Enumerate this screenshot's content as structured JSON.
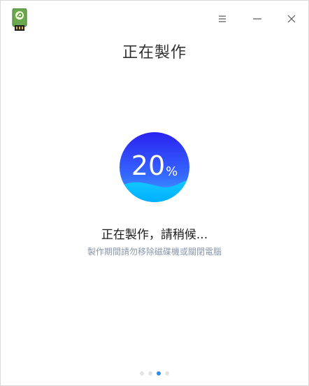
{
  "window": {
    "app_icon": "usb-drive-icon",
    "controls": [
      "menu-icon",
      "minimize-icon",
      "close-icon"
    ]
  },
  "page": {
    "title": "正在製作"
  },
  "progress": {
    "value": 20,
    "number": "20",
    "unit": "%",
    "colors": {
      "top": "#2a36f0",
      "bottom": "#3fa6ff",
      "wave": "#00c8ff"
    }
  },
  "status": {
    "message": "正在製作，請稍候...",
    "hint": "製作期間請勿移除磁碟機或關閉電腦"
  },
  "steps": {
    "count": 4,
    "active": 3,
    "active_color": "#2e8dea",
    "inactive_color": "#e3e3e3"
  }
}
